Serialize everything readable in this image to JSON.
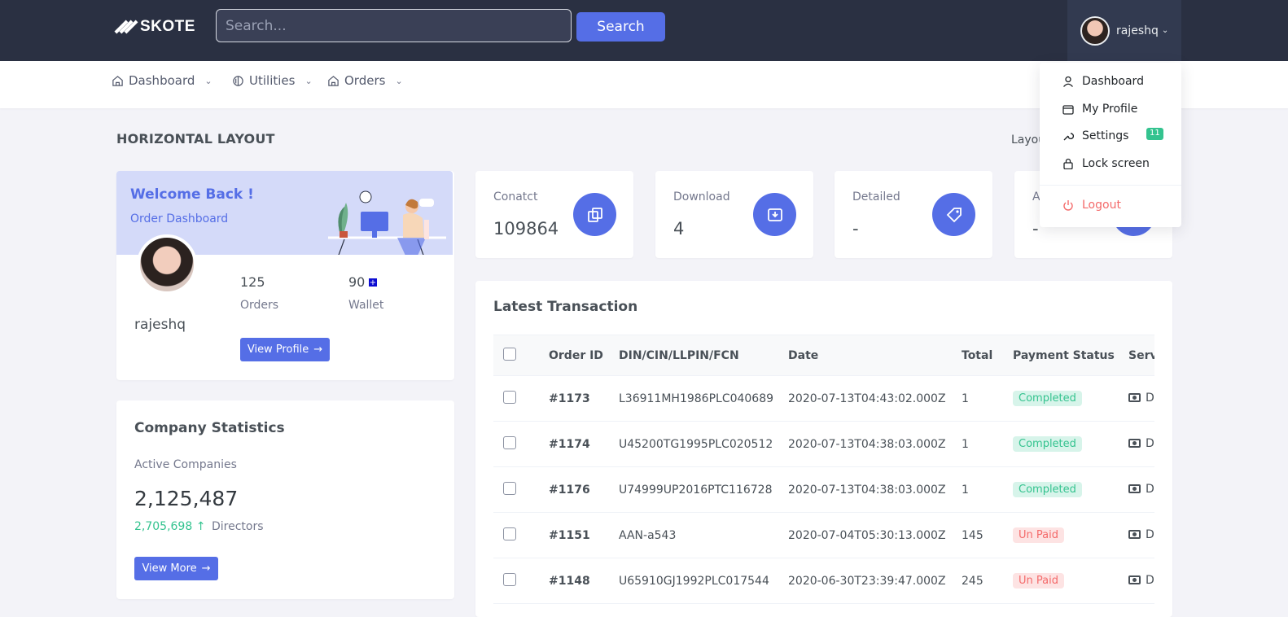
{
  "header": {
    "logo_text": "SKOTE",
    "search_placeholder": "Search...",
    "search_button": "Search",
    "user_name": "rajeshq"
  },
  "nav": {
    "items": [
      {
        "label": "Dashboard",
        "icon": "home-icon"
      },
      {
        "label": "Utilities",
        "icon": "utilities-icon"
      },
      {
        "label": "Orders",
        "icon": "home-icon"
      }
    ]
  },
  "page": {
    "title": "HORIZONTAL LAYOUT",
    "breadcrumb": "Layou"
  },
  "welcome": {
    "title": "Welcome Back !",
    "subtitle": "Order Dashboard",
    "name": "rajeshq",
    "orders_value": "125",
    "orders_label": "Orders",
    "wallet_value": "90",
    "wallet_label": "Wallet",
    "button": "View Profile"
  },
  "company": {
    "title": "Company Statistics",
    "label": "Active Companies",
    "value": "2,125,487",
    "growth": "2,705,698",
    "growth_label": "Directors",
    "button": "View More"
  },
  "mini_stats": [
    {
      "label": "Conatct",
      "value": "109864",
      "icon": "copy-icon"
    },
    {
      "label": "Download",
      "value": "4",
      "icon": "archive-icon"
    },
    {
      "label": "Detailed",
      "value": "-",
      "icon": "tag-icon"
    },
    {
      "label": "A",
      "value": "-",
      "icon": "stat-icon"
    }
  ],
  "transactions": {
    "title": "Latest Transaction",
    "columns": [
      "Order ID",
      "DIN/CIN/LLPIN/FCN",
      "Date",
      "Total",
      "Payment Status",
      "Servi"
    ],
    "rows": [
      {
        "order_id": "#1173",
        "din": "L36911MH1986PLC040689",
        "date": "2020-07-13T04:43:02.000Z",
        "total": "1",
        "status": "Completed",
        "service": "D"
      },
      {
        "order_id": "#1174",
        "din": "U45200TG1995PLC020512",
        "date": "2020-07-13T04:38:03.000Z",
        "total": "1",
        "status": "Completed",
        "service": "D"
      },
      {
        "order_id": "#1176",
        "din": "U74999UP2016PTC116728",
        "date": "2020-07-13T04:38:03.000Z",
        "total": "1",
        "status": "Completed",
        "service": "D"
      },
      {
        "order_id": "#1151",
        "din": "AAN-a543",
        "date": "2020-07-04T05:30:13.000Z",
        "total": "145",
        "status": "Un Paid",
        "service": "D"
      },
      {
        "order_id": "#1148",
        "din": "U65910GJ1992PLC017544",
        "date": "2020-06-30T23:39:47.000Z",
        "total": "245",
        "status": "Un Paid",
        "service": "D"
      }
    ]
  },
  "dropdown": {
    "items": [
      {
        "label": "Dashboard",
        "icon": "user-icon"
      },
      {
        "label": "My Profile",
        "icon": "wallet-icon"
      },
      {
        "label": "Settings",
        "icon": "wrench-icon"
      },
      {
        "label": "Lock screen",
        "icon": "lock-icon"
      }
    ],
    "settings_badge": "11",
    "logout": "Logout"
  },
  "colors": {
    "topbar": "#2a3042",
    "primary": "#556ee6",
    "success": "#34c38f",
    "danger": "#f46a6a"
  }
}
